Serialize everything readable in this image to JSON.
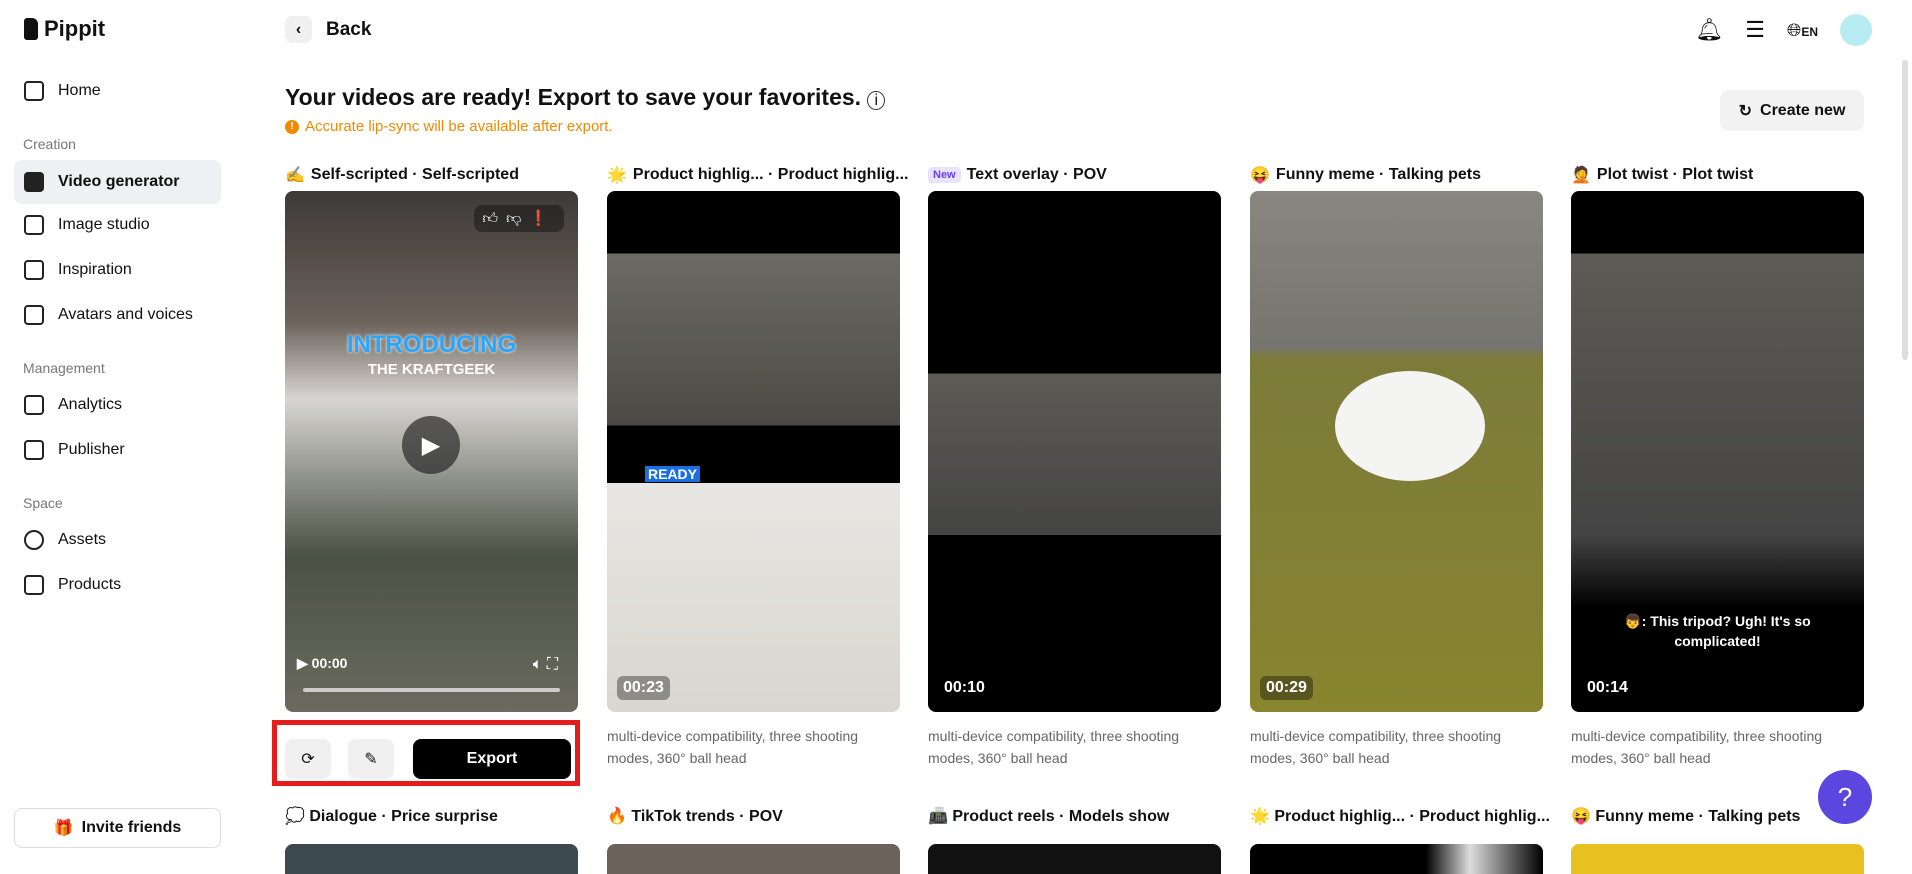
{
  "app": {
    "name": "Pippit"
  },
  "sidebar": {
    "items": [
      {
        "label": "Home",
        "section": null
      },
      {
        "label": "Video generator",
        "active": true
      },
      {
        "label": "Image studio"
      },
      {
        "label": "Inspiration"
      },
      {
        "label": "Avatars and voices"
      },
      {
        "label": "Analytics"
      },
      {
        "label": "Publisher"
      },
      {
        "label": "Assets"
      },
      {
        "label": "Products"
      }
    ],
    "sections": [
      "Creation",
      "Management",
      "Space"
    ],
    "invite": "Invite friends"
  },
  "header": {
    "back": "Back",
    "lang": "EN"
  },
  "main": {
    "title": "Your videos are ready! Export to save your favorites.",
    "warning": "Accurate lip-sync will be available after export.",
    "create_new": "Create new",
    "cards": [
      {
        "emoji": "✍️",
        "label": "Self-scripted · Self-scripted",
        "time": "00:00",
        "overlay1": "INTRODUCING",
        "overlay2": "THE KRAFTGEEK"
      },
      {
        "emoji": "🌟",
        "label": "Product highlig... · Product highlig...",
        "time": "00:23",
        "overlay1": "READY",
        "desc": "multi-device compatibility, three shooting modes, 360° ball head"
      },
      {
        "badge": "New",
        "label": "Text overlay · POV",
        "time": "00:10",
        "desc": "multi-device compatibility, three shooting modes, 360° ball head"
      },
      {
        "emoji": "😝",
        "label": "Funny meme · Talking pets",
        "time": "00:29",
        "desc": "multi-device compatibility, three shooting modes, 360° ball head"
      },
      {
        "emoji": "🤦",
        "label": "Plot twist · Plot twist",
        "time": "00:14",
        "caption": "👦: This tripod? Ugh! It's so complicated!",
        "desc": "multi-device compatibility, three shooting modes, 360° ball head"
      }
    ],
    "export": "Export",
    "row2": [
      "💭 Dialogue · Price surprise",
      "🔥 TikTok trends · POV",
      "📠 Product reels · Models show",
      "🌟 Product highlig... · Product highlig...",
      "😝 Funny meme · Talking pets"
    ]
  }
}
